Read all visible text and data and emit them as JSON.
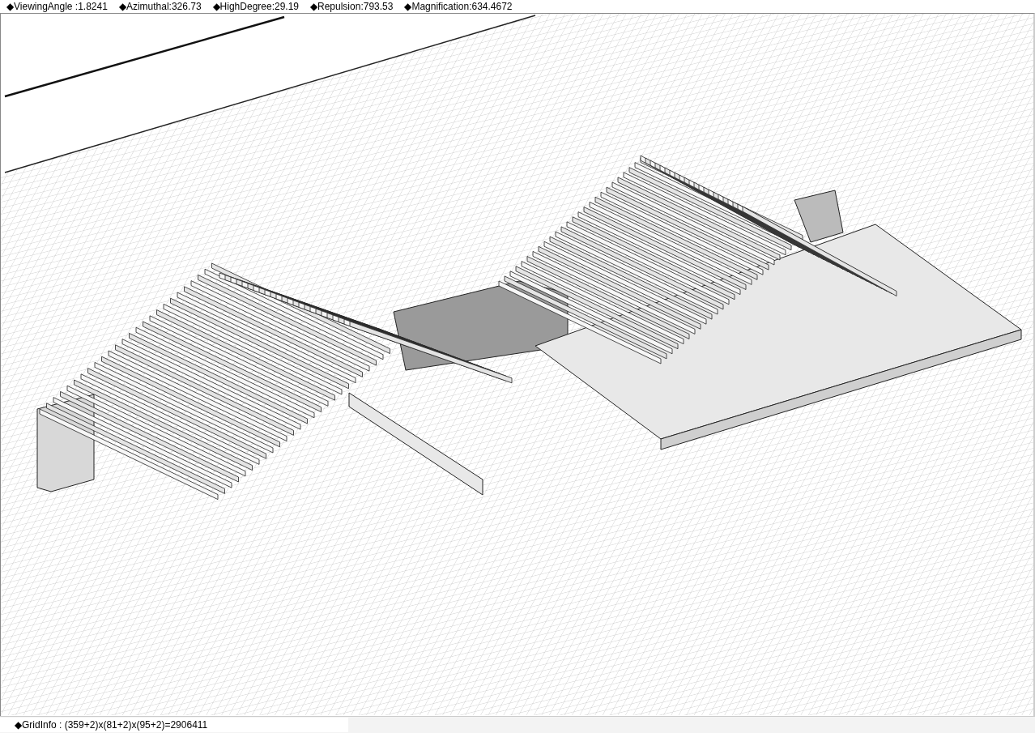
{
  "readouts": [
    "◆ViewingAngle :1.8241",
    "◆Azimuthal:326.73",
    "◆HighDegree:29.19",
    "◆Repulsion:793.53",
    "◆Magnification:634.4672"
  ],
  "status_bar": {
    "grid_info": "◆GridInfo : (359+2)x(81+2)x(95+2)=2906411"
  }
}
